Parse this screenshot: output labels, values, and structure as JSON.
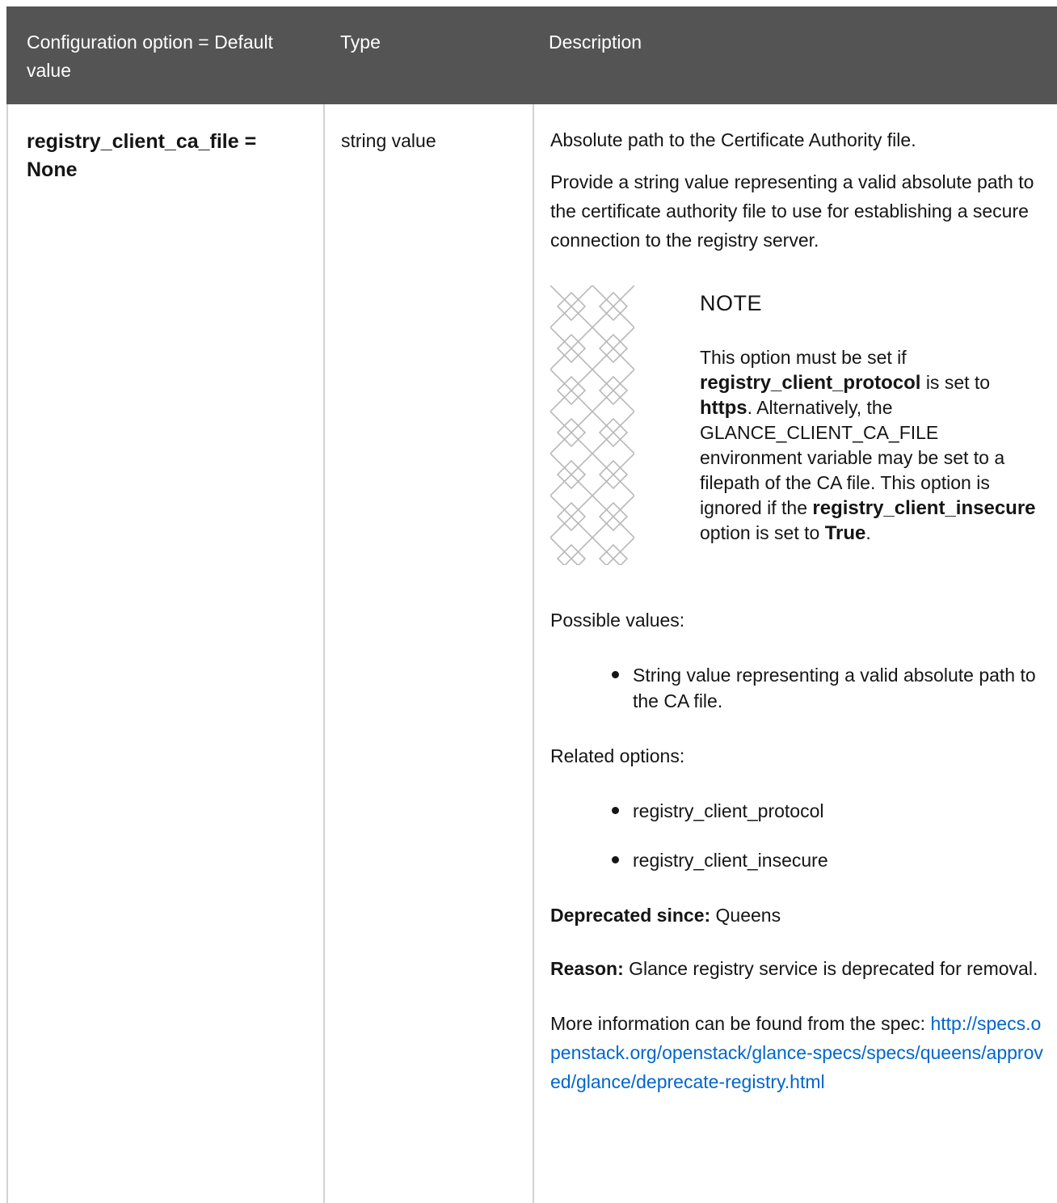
{
  "table": {
    "headers": {
      "option": "Configuration option = Default value",
      "type": "Type",
      "description": "Description"
    },
    "row": {
      "option_name": "registry_client_ca_file = None",
      "type": "string value",
      "description": {
        "summary": "Absolute path to the Certificate Authority file.",
        "detail": "Provide a string value representing a valid absolute path to the certificate authority file to use for establishing a secure connection to the registry server.",
        "note": {
          "title": "NOTE",
          "text_1": "This option must be set if",
          "bold_1": "registry_client_protocol",
          "text_2": "is set to",
          "bold_2": "https",
          "text_3": ". Alternatively, the GLANCE_CLIENT_CA_FILE environment variable may be set to a filepath of the CA file. This option is ignored if the",
          "bold_3": "registry_client_insecure",
          "text_4": "option is set to",
          "bold_4": "True",
          "text_5": "."
        },
        "possible_values_label": "Possible values:",
        "possible_values": [
          "String value representing a valid absolute path to the CA file."
        ],
        "related_options_label": "Related options:",
        "related_options": [
          "registry_client_protocol",
          "registry_client_insecure"
        ],
        "deprecated_label": "Deprecated since:",
        "deprecated_value": "Queens",
        "reason_label": "Reason:",
        "reason_value": "Glance registry service is deprecated for removal.",
        "more_info": "More information can be found from the spec:",
        "spec_link": "http://specs.openstack.org/openstack/glance-specs/specs/queens/approved/glance/deprecate-registry.html"
      }
    }
  },
  "colors": {
    "header_bg": "#545454",
    "border": "#d2d2d2",
    "link": "#0066cc",
    "text": "#151515"
  },
  "icons": {
    "note": "note-pattern-icon",
    "bullet": "bullet-icon"
  }
}
